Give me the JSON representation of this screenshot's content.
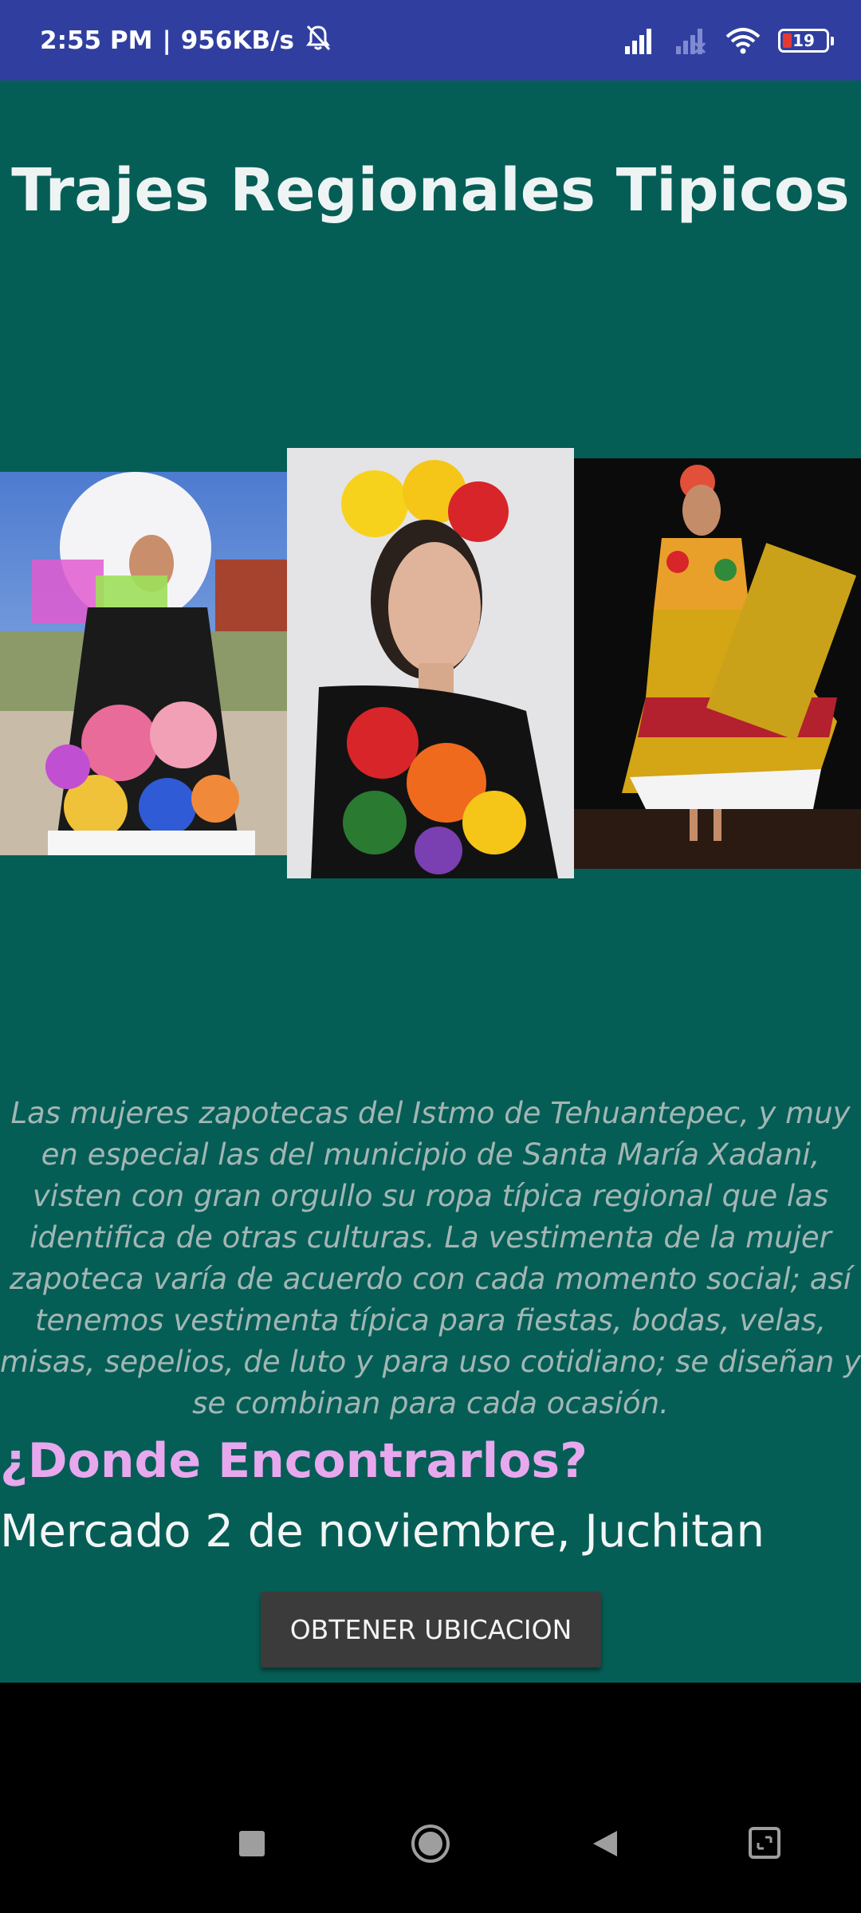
{
  "status_bar": {
    "time": "2:55 PM",
    "separator": "|",
    "network_speed": "956KB/s",
    "battery_level": "19",
    "icons": [
      "bell-off-icon",
      "signal-icon",
      "signal-no-service-icon",
      "wifi-icon",
      "battery-icon"
    ]
  },
  "page": {
    "title": "Trajes Regionales Tipicos",
    "description": "Las mujeres zapotecas del Istmo de Tehuantepec, y muy en especial las del municipio de Santa María Xadani, visten con gran orgullo su ropa típica regional que las identifica de otras culturas. La vestimenta de la mujer zapoteca varía de acuerdo con cada momento social; así tenemos vestimenta típica para fiestas, bodas, velas, misas, sepelios, de luto y para uso cotidiano; se diseñan y se combinan para cada ocasión.",
    "where_title": "¿Donde Encontrarlos?",
    "place_name": "Mercado 2 de noviembre, Juchitan",
    "location_button": "OBTENER UBICACION"
  },
  "colors": {
    "status_bar": "#303f9f",
    "background": "#055e56",
    "where_title": "#e8a8ee",
    "button": "#3b3b3b"
  },
  "nav_bar": {
    "icons": [
      "recent-apps-icon",
      "home-icon",
      "back-icon",
      "screenshot-icon"
    ]
  }
}
